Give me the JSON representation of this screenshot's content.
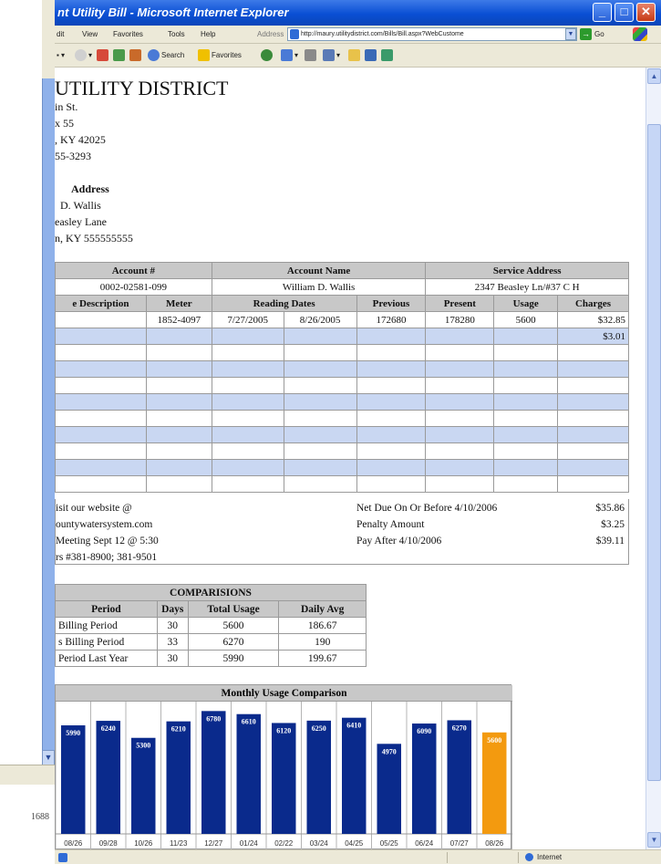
{
  "behind_window": {
    "partial_number": "1688"
  },
  "ie": {
    "title": "nt Utility Bill - Microsoft Internet Explorer",
    "menu": [
      "dit",
      "View",
      "Favorites",
      "Tools",
      "Help"
    ],
    "address_label": "Address",
    "address_url": "http://maury.utilitydistrict.com/Bills/Bill.aspx?WebCustome",
    "go_label": "Go",
    "toolbar": {
      "search": "Search",
      "favorites": "Favorites"
    },
    "status_zone": "Internet"
  },
  "bill": {
    "company": "UTILITY DISTRICT",
    "company_address": [
      "in St.",
      "x 55",
      ", KY 42025",
      "55-3293"
    ],
    "billing_address_heading": "Address",
    "billing_address": [
      "D. Wallis",
      "easley Lane",
      "n, KY 555555555"
    ],
    "account_headers": [
      "Account #",
      "Account Name",
      "Service Address"
    ],
    "account": {
      "number": "0002-02581-099",
      "name": "William D. Wallis",
      "service_address": "2347 Beasley Ln/#37 C H"
    },
    "service_headers": [
      "e Description",
      "Meter",
      "Reading Dates",
      "Previous",
      "Present",
      "Usage",
      "Charges"
    ],
    "service_row": {
      "meter": "1852-4097",
      "date_from": "7/27/2005",
      "date_to": "8/26/2005",
      "previous": "172680",
      "present": "178280",
      "usage": "5600",
      "charges": "$32.85"
    },
    "second_charge": "$3.01",
    "footer_left": [
      "isit our website @",
      "ountywatersystem.com",
      "Meeting Sept 12 @ 5:30",
      "rs #381-8900; 381-9501"
    ],
    "footer_right": [
      {
        "label": "Net Due On Or Before 4/10/2006",
        "amount": "$35.86"
      },
      {
        "label": "Penalty Amount",
        "amount": "$3.25"
      },
      {
        "label": "Pay After 4/10/2006",
        "amount": "$39.11"
      }
    ]
  },
  "comparisons": {
    "title": "COMPARISIONS",
    "headers": [
      "Period",
      "Days",
      "Total Usage",
      "Daily Avg"
    ],
    "rows": [
      [
        "Billing Period",
        "30",
        "5600",
        "186.67"
      ],
      [
        "s Billing Period",
        "33",
        "6270",
        "190"
      ],
      [
        "Period Last Year",
        "30",
        "5990",
        "199.67"
      ]
    ]
  },
  "chart_data": {
    "type": "bar",
    "title": "Monthly Usage Comparison",
    "categories": [
      "08/26",
      "09/28",
      "10/26",
      "11/23",
      "12/27",
      "01/24",
      "02/22",
      "03/24",
      "04/25",
      "05/25",
      "06/24",
      "07/27",
      "08/26"
    ],
    "values": [
      5990,
      6240,
      5300,
      6210,
      6780,
      6610,
      6120,
      6250,
      6410,
      4970,
      6090,
      6270,
      5600
    ],
    "ylim": [
      0,
      7200
    ],
    "colors": {
      "past": "#0a2a8c",
      "current": "#f39a0f"
    },
    "highlight_index": 12
  }
}
